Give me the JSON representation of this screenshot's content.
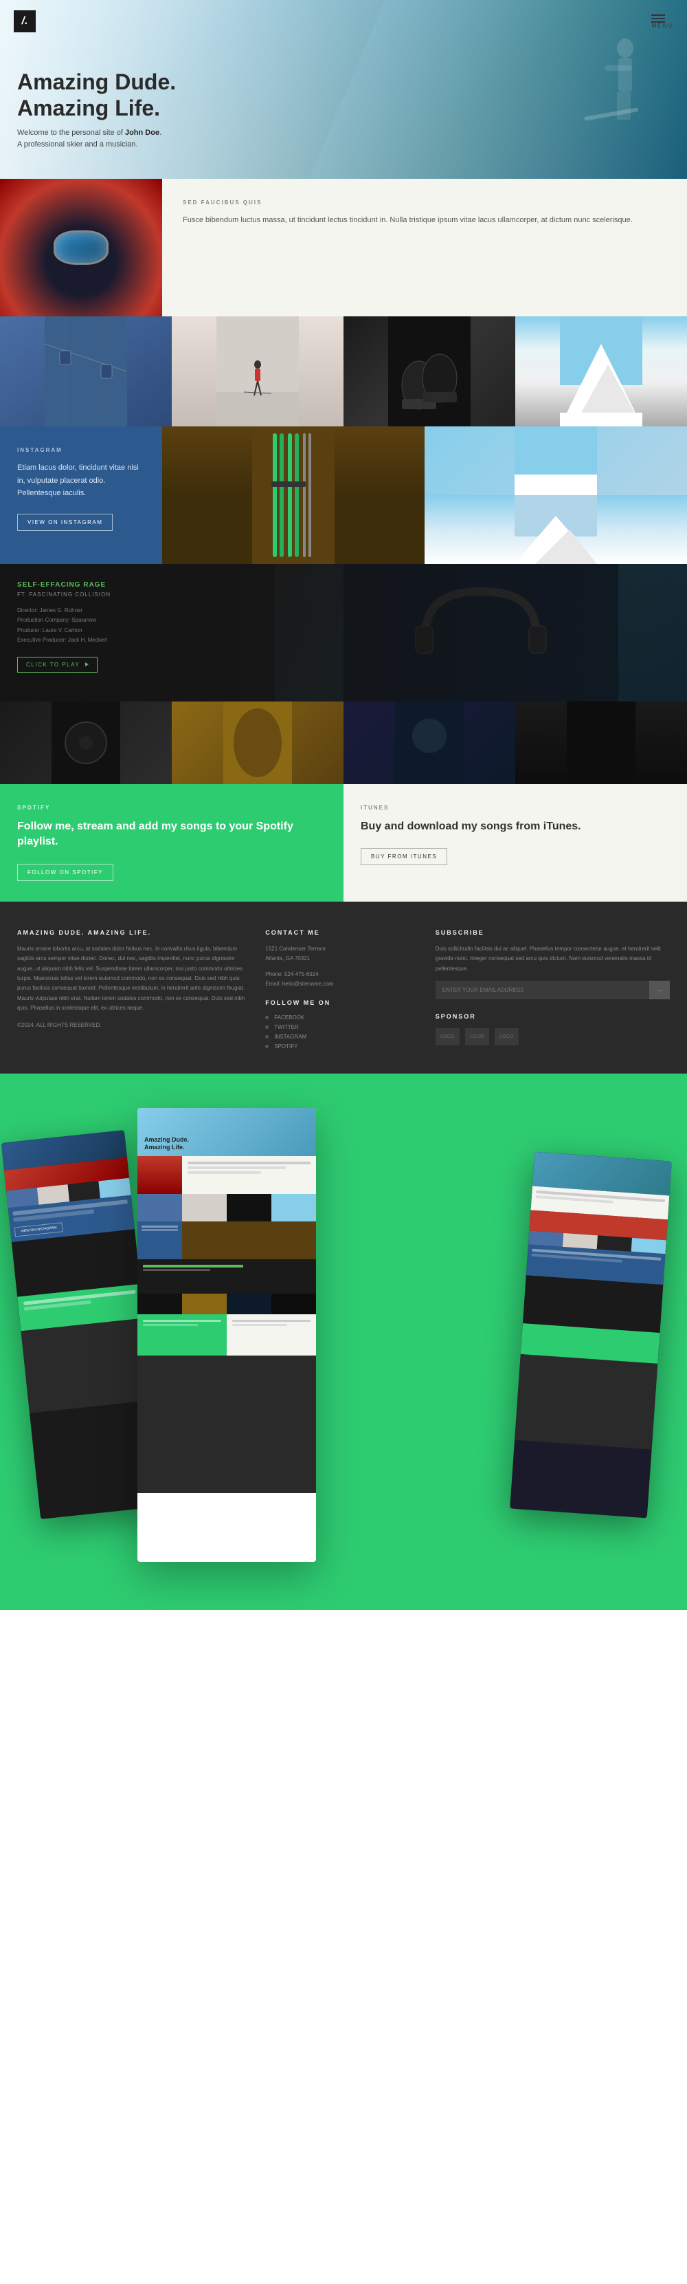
{
  "header": {
    "logo": "/.",
    "menu_label": "MENU",
    "title_line1": "Amazing Dude.",
    "title_line2": "Amazing Life.",
    "subtitle": "Welcome to the personal site of",
    "name_bold": "John Doe",
    "subtitle_end": "A professional skier and a musician."
  },
  "section_info": {
    "tag": "SED FAUCIBUS QUIS",
    "body": "Fusce bibendum luctus massa, ut tincidunt lectus tincidunt in. Nulla tristique ipsum vitae lacus ullamcorper, at dictum nunc scelerisque."
  },
  "instagram": {
    "label": "INSTAGRAM",
    "body": "Etiam lacus dolor, tincidunt vitae nisi in, vulputate placerat odio. Pellentesque iaculis.",
    "button": "VIEW ON INSTAGRAM"
  },
  "music": {
    "title": "SELF-EFFACING RAGE",
    "subtitle": "FT. FASCINATING COLLISION",
    "director": "Director: James G. Rohner",
    "production": "Production Company: Sparanow",
    "producer": "Producer: Laura V. Carlton",
    "exec_producer": "Executive Producer: Jack H. Meckert",
    "button": "CLICK TO PLAY"
  },
  "spotify": {
    "label": "SPOTIFY",
    "title": "Follow me, stream and add my songs to your Spotify playlist.",
    "button": "FOLLOW ON SPOTIFY"
  },
  "itunes": {
    "label": "ITUNES",
    "title": "Buy and download my songs from iTunes.",
    "button": "BUY FROM ITUNES"
  },
  "footer": {
    "brand_title": "AMAZING DUDE. AMAZING LIFE.",
    "brand_text": "Mauris ornare lobortis arcu, at sodales dolor finibus nec. In convallis risus ligula, bibendum sagittis arcu semper vitae donec. Donec, dui nec, sagittis imperdiet, nunc purus dignissim augue, ut aliquam nibh felis vel. Suspendisse lorem ullamcorper, nisi justo commodo ultricies turpis. Maecenas tellus vel lorem euismod commodo, non ex consequat. Duis sed nibh quis purus facilisis consequat laoreet. Pellentesque vestibulum, in hendrerit ante dignissim feugiat. Mauris vulputate nibh erat. Nullam lorem sodales commodo, non ex consequat. Duis sed nibh quis. Phasellus in scelerisque elit, ex ultrices neque.",
    "copyright": "©2014. ALL RIGHTS RESERVED.",
    "contact_heading": "CONTACT ME",
    "address_line1": "1521 Condenser Terrace",
    "address_line2": "Atlanta, GA 70321",
    "phone": "Phone: 524-475-6924",
    "email_label": "Email:",
    "email": "hello@sitename.com",
    "follow_heading": "FOLLOW ME ON",
    "social_links": [
      "FACEBOOK",
      "TWITTER",
      "INSTAGRAM",
      "SPOTIFY"
    ],
    "subscribe_heading": "SUBSCRIBE",
    "subscribe_text": "Duis sollicitudin facilisis dui ac aliquet. Phasellus tempor consectetur augue, et hendrerit velit gravida nunc. Integer consequat sed arcu quis dictum. Nam euismod venenatis massa id pellentesque.",
    "subscribe_placeholder": "ENTER YOUR EMAIL ADDRESS",
    "subscribe_button": "→",
    "sponsor_heading": "SPONSOR",
    "sponsor_logos": [
      "LOGO",
      "LOGO",
      "LOGO"
    ]
  }
}
